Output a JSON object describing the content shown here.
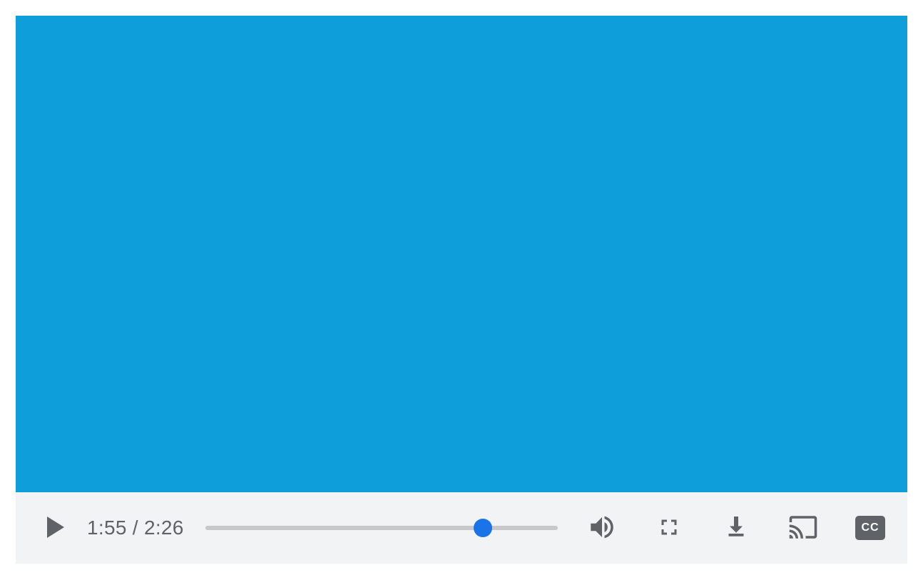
{
  "player": {
    "current_time": "1:55",
    "total_time": "2:26",
    "time_separator": " / ",
    "progress_percent": 78.7,
    "video_bg_color": "#0e9fda",
    "controls_bg_color": "#f1f3f4",
    "icon_color": "#5f6368",
    "thumb_color": "#1a73e8",
    "cc_label": "CC",
    "icons": {
      "play": "play-icon",
      "volume": "volume-icon",
      "fullscreen": "fullscreen-icon",
      "download": "download-icon",
      "cast": "cast-icon",
      "captions": "captions-icon"
    }
  }
}
